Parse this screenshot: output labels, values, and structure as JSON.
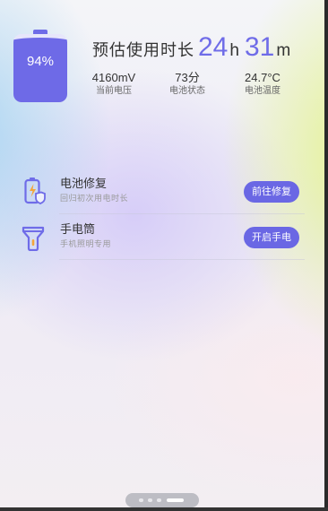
{
  "battery": {
    "percent_label": "94%",
    "level": 0.94,
    "color": "#6e6ae7"
  },
  "estimate": {
    "label": "预估使用时长",
    "hours": "24",
    "hours_unit": "h",
    "minutes": "31",
    "minutes_unit": "m"
  },
  "stats": [
    {
      "value": "4160mV",
      "label": "当前电压"
    },
    {
      "value": "73分",
      "label": "电池状态"
    },
    {
      "value": "24.7°C",
      "label": "电池温度"
    }
  ],
  "tools": [
    {
      "title": "电池修复",
      "subtitle": "回归初次用电时长",
      "button": "前往修复",
      "icon": "battery-repair-icon"
    },
    {
      "title": "手电筒",
      "subtitle": "手机照明专用",
      "button": "开启手电",
      "icon": "flashlight-icon"
    }
  ],
  "pager": {
    "pages": 4,
    "active": 4
  },
  "colors": {
    "accent": "#6a67e4",
    "accent_light": "#e7e6fb"
  }
}
